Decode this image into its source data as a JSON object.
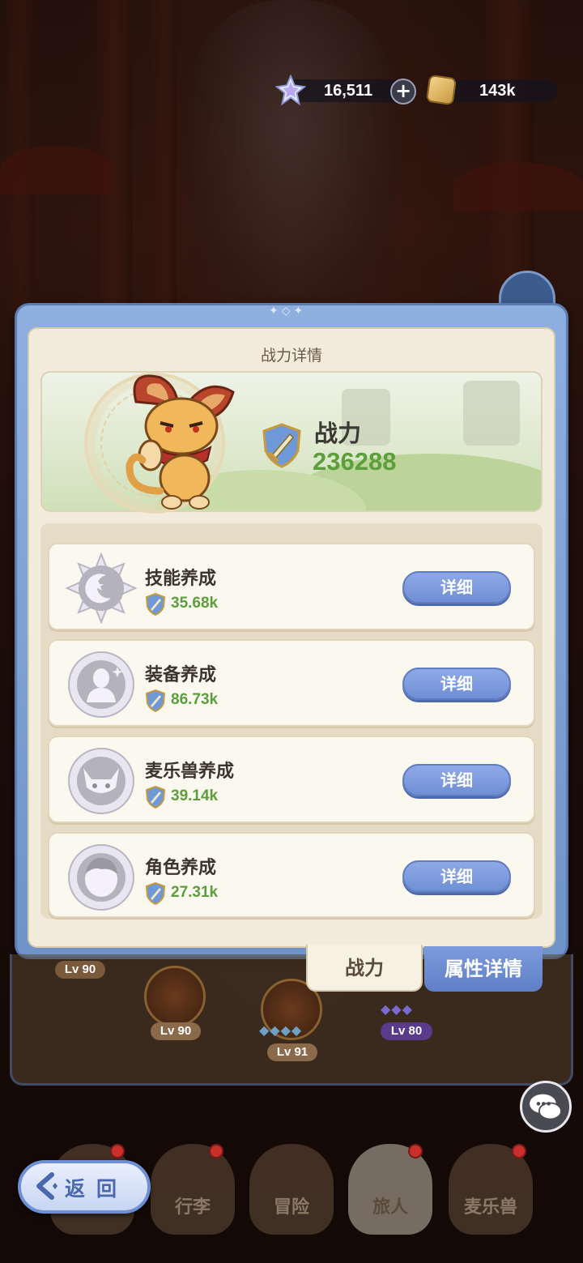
{
  "currency": {
    "gems": "16,511",
    "gold": "143k",
    "gem_icon": "star-crystal-icon",
    "gold_icon": "gold-coin-icon",
    "plus_icon": "plus-icon"
  },
  "panel": {
    "title": "战力详情",
    "total_power_label": "战力",
    "total_power_value": "236288"
  },
  "categories": [
    {
      "label": "技能养成",
      "value": "35.68k",
      "button": "详细",
      "icon": "moon-star-icon"
    },
    {
      "label": "装备养成",
      "value": "86.73k",
      "button": "详细",
      "icon": "figure-icon"
    },
    {
      "label": "麦乐兽养成",
      "value": "39.14k",
      "button": "详细",
      "icon": "cat-face-icon"
    },
    {
      "label": "角色养成",
      "value": "27.31k",
      "button": "详细",
      "icon": "character-head-icon"
    }
  ],
  "tabs": {
    "power": "战力",
    "attributes": "属性详情"
  },
  "background_levels": [
    "Lv 90",
    "Lv 90",
    "Lv 91",
    "Lv 80"
  ],
  "nav": {
    "back": "返回",
    "items": [
      "行李",
      "冒险",
      "旅人",
      "麦乐兽"
    ]
  },
  "colors": {
    "accent_blue": "#6f8fd5",
    "power_green": "#5c9e3c",
    "panel_cream": "#f3ecdc"
  }
}
